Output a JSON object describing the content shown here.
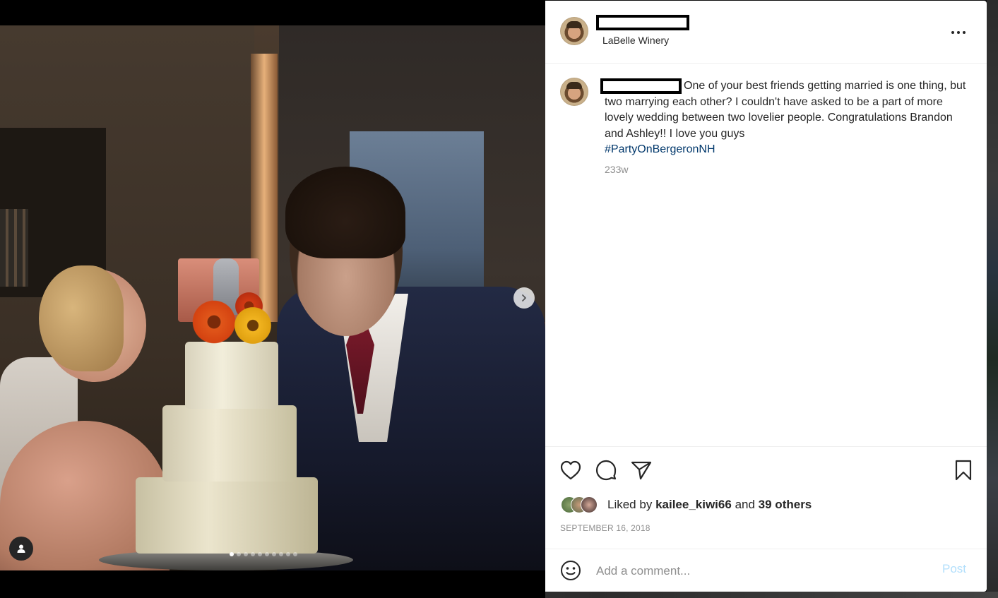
{
  "post": {
    "location": "LaBelle Winery",
    "caption": "One of your best friends getting married is one thing, but two marrying each other? I couldn't have asked to be a part of more lovely wedding between two lovelier people. Congratulations Brandon and Ashley!! I love you guys",
    "hashtag": "#PartyOnBergeronNH",
    "time_ago": "233w",
    "liked_by_prefix": "Liked by",
    "liked_by_user": "kailee_kiwi66",
    "liked_by_and": "and",
    "liked_by_others": "39 others",
    "date": "SEPTEMBER 16, 2018"
  },
  "media": {
    "carousel_count": 10,
    "carousel_active_index": 0
  },
  "comment": {
    "placeholder": "Add a comment...",
    "post_label": "Post"
  },
  "icons": {
    "more": "more-horizontal-icon",
    "like": "heart-icon",
    "comment": "comment-bubble-icon",
    "share": "paper-plane-icon",
    "save": "bookmark-icon",
    "emoji": "smiley-icon",
    "next": "chevron-right-icon",
    "tags": "user-tag-icon"
  },
  "colors": {
    "hashtag": "#00376b",
    "post_button_disabled": "#b2dffc",
    "muted_text": "#8e8e8e",
    "text": "#262626"
  }
}
